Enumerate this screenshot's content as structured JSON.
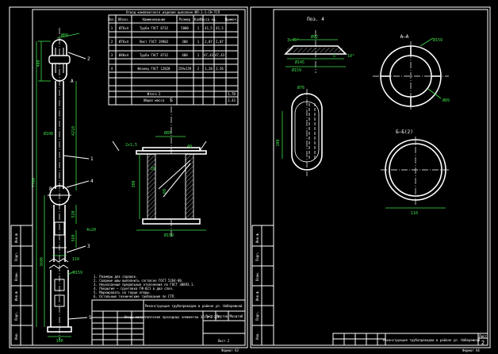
{
  "sheet_left": {
    "spec_title": "Отвод комплектного изделия выполнен ЮП-1-1-СН-ТСП",
    "spec_headers": [
      "Поз.",
      "Обозн.",
      "Наименование",
      "Размер",
      "Кол.",
      "Масса ед.",
      "Примеч."
    ],
    "spec_rows": [
      [
        "1",
        "Ø76х4",
        "Труба ГОСТ 8732",
        "5800",
        "1",
        "41,5",
        "41,5"
      ],
      [
        "2",
        "Ø76х4",
        "Лист ГОСТ 19903",
        "300",
        "1",
        "2,07",
        "2,07"
      ],
      [
        "3",
        "Ø40х4",
        "Труба ГОСТ 8732",
        "400",
        "1",
        "47,43",
        "47,43"
      ],
      [
        "4",
        "",
        "Фланец ГОСТ 12820",
        "159x159",
        "2",
        "1,28",
        "2,56"
      ]
    ],
    "spec_totals": [
      "Итого 2",
      "Общая масса"
    ],
    "spec_total_values": [
      "1,78",
      "2,43"
    ],
    "dims": {
      "top_dia": "Ø89",
      "d400": "400",
      "d4210": "4210",
      "d7700": "7700",
      "d3600": "3600",
      "d560": "560",
      "dia_mid": "Ø108",
      "d520": "520",
      "d110": "110",
      "d100": "100",
      "dia_bottom": "Ø159",
      "d4x20": "4x20",
      "leaders": [
        "1",
        "2",
        "3",
        "4",
        "5"
      ],
      "section_A": "A",
      "node_B": "B"
    },
    "view_b": {
      "label": "Б",
      "dia_top": "Ø89",
      "dia_bottom": "Ø159",
      "d300": "300",
      "d20": "20",
      "d60": "60",
      "d40": "40",
      "chamfer": "2x1,5"
    },
    "notes": [
      "1. Размеры для справок.",
      "2. Сварные швы выполнить согласно ГОСТ 5264-80.",
      "3. Неуказанные предельные отклонения по ГОСТ 30893.1.",
      "4. Покрытие — грунтовка ГФ-021 в два слоя.",
      "5. Маркировать на торце опоры.",
      "6. Остальные технические требования по СТП."
    ],
    "stamp_header": "Реконструкция трубопроводов в районе ул. Набережной",
    "stamp_title": "Опоры металлические проходных элементов ЭЛ-1-1-Э(Г)",
    "stamp_codes": [
      "Лист",
      "Листов",
      "Масштаб"
    ],
    "stamp_sheet": "Лист 2",
    "format": "Формат А3"
  },
  "sheet_right": {
    "pos_label": "Поз. 4",
    "chamfer": "3х45°",
    "dia_92": "Ø92",
    "dia_145": "Ø145",
    "dia_159": "Ø159",
    "angle": "10°",
    "d5": "5",
    "section_AA": "А–А",
    "aa_dia_159": "Ø159",
    "aa_dia_89": "Ø89",
    "dia_76": "Ø76",
    "d100": "100",
    "section_BB": "Б–Б(2)",
    "d110": "110",
    "stamp_header": "Реконструкция трубопроводов в районе ул. Набережной",
    "stamp_sheet_no": "2",
    "stamp_sheet": "Лист",
    "format": "Формат А4"
  }
}
